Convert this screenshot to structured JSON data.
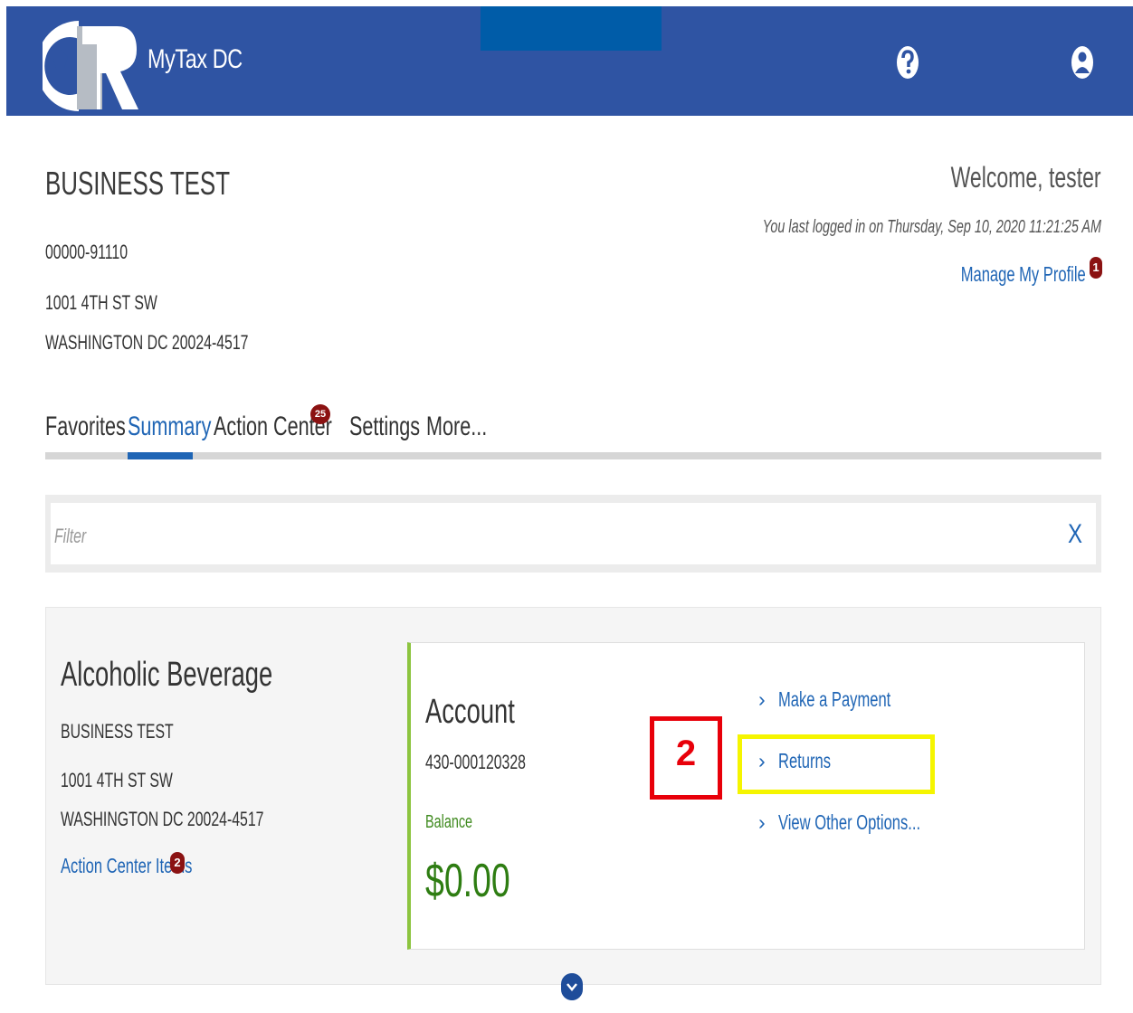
{
  "app": {
    "title": "MyTax DC",
    "logo_icon": "otr-logo-icon"
  },
  "header": {
    "help_icon": "help-icon",
    "user_icon": "user-icon"
  },
  "business": {
    "name": "BUSINESS TEST",
    "id": "00000-91110",
    "address_line1": "1001 4TH ST SW",
    "address_line2": "WASHINGTON DC 20024-4517"
  },
  "user": {
    "welcome": "Welcome, tester",
    "last_login": "You last logged in on Thursday, Sep 10, 2020 11:21:25 AM",
    "manage_profile": "Manage My Profile",
    "profile_badge": "1"
  },
  "tabs": [
    {
      "label": "Favorites"
    },
    {
      "label": "Summary",
      "active": true
    },
    {
      "label": "Action Center",
      "badge": "25"
    },
    {
      "label": "Settings"
    },
    {
      "label": "More..."
    }
  ],
  "filter": {
    "placeholder": "Filter",
    "clear_label": "X"
  },
  "account_card": {
    "title": "Alcoholic Beverage",
    "business_name": "BUSINESS TEST",
    "address_line1": "1001 4TH ST SW",
    "address_line2": "WASHINGTON DC 20024-4517",
    "action_center_items": "Action Center Items",
    "action_center_badge": "2",
    "account_label": "Account",
    "account_number": "430-000120328",
    "balance_label": "Balance",
    "balance_value": "$0.00",
    "actions": [
      {
        "label": "Make a Payment"
      },
      {
        "label": "Returns"
      },
      {
        "label": "View Other Options..."
      }
    ]
  },
  "annotation": {
    "step_number": "2",
    "step_color": "#e8000a",
    "highlight_color": "#f5f500"
  },
  "colors": {
    "header_bg": "#2f54a3",
    "link": "#1f65b5",
    "accent_green": "#8cc43f",
    "balance_green": "#2e7d12",
    "badge": "#8b1212"
  }
}
